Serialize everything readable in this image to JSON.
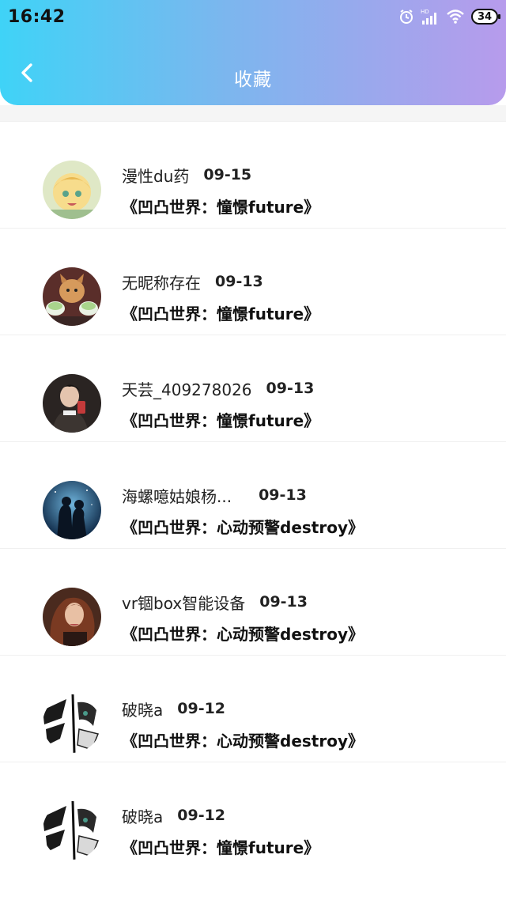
{
  "status_bar": {
    "time": "16:42",
    "battery_level": "34",
    "icons": [
      "alarm-icon",
      "hd-signal-icon",
      "wifi-icon",
      "battery-icon"
    ]
  },
  "header": {
    "title": "收藏",
    "back_icon": "chevron-left-icon"
  },
  "colors": {
    "header_gradient_start": "#3fd3f7",
    "header_gradient_end": "#b79bec",
    "text_primary": "#222222"
  },
  "favorites": [
    {
      "username": "漫性du药",
      "date": "09-15",
      "book": "《凹凸世界：憧憬future》",
      "avatar": "anime-blonde-girl"
    },
    {
      "username": "无昵称存在",
      "date": "09-13",
      "book": "《凹凸世界：憧憬future》",
      "avatar": "cat-meme"
    },
    {
      "username": "天芸_409278026",
      "date": "09-13",
      "book": "《凹凸世界：憧憬future》",
      "avatar": "man-dark-photo"
    },
    {
      "username": "海螺噫姑娘杨...",
      "date": "09-13",
      "book": "《凹凸世界：心动预警destroy》",
      "avatar": "couple-silhouette"
    },
    {
      "username": "vr锢box智能设备",
      "date": "09-13",
      "book": "《凹凸世界：心动预警destroy》",
      "avatar": "woman-portrait"
    },
    {
      "username": "破晓a",
      "date": "09-12",
      "book": "《凹凸世界：心动预警destroy》",
      "avatar": "manga-character"
    },
    {
      "username": "破晓a",
      "date": "09-12",
      "book": "《凹凸世界：憧憬future》",
      "avatar": "manga-character"
    }
  ]
}
